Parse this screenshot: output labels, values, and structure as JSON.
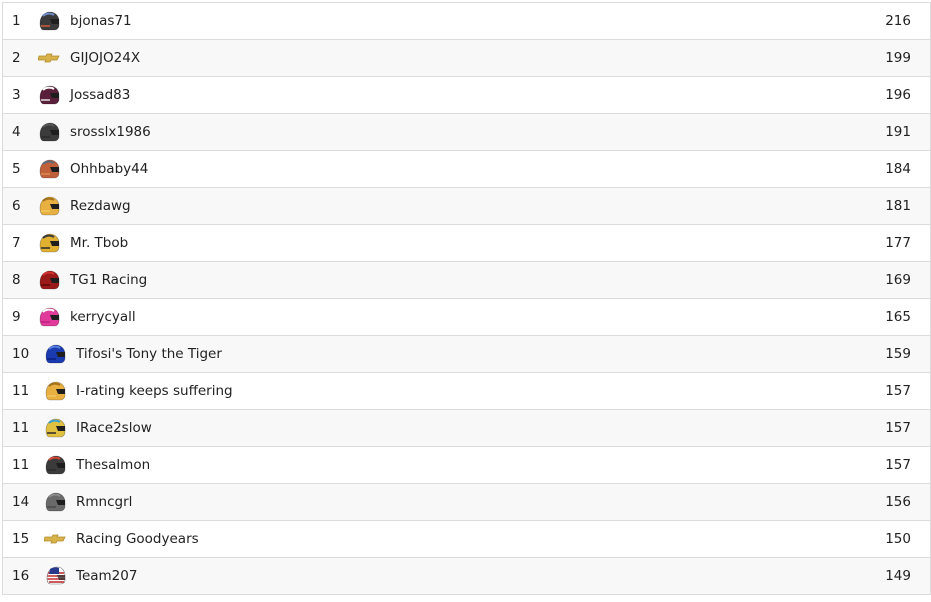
{
  "leaderboard": [
    {
      "rank": "1",
      "name": "bjonas71",
      "score": "216",
      "helmet": {
        "icon": "helmet-icon",
        "color": "#3a3a3a",
        "accent": "#6b8cc7",
        "stripe": "#d05a3a"
      }
    },
    {
      "rank": "2",
      "name": "GIJOJO24X",
      "score": "199",
      "helmet": {
        "icon": "chevrolet-bowtie-icon",
        "color": "#d8b24a",
        "accent": "#b08a2a",
        "stripe": "#d8b24a"
      }
    },
    {
      "rank": "3",
      "name": "Jossad83",
      "score": "196",
      "helmet": {
        "icon": "helmet-icon",
        "color": "#5a1f3a",
        "accent": "#ffffff",
        "stripe": "#e0e0e0"
      }
    },
    {
      "rank": "4",
      "name": "srosslx1986",
      "score": "191",
      "helmet": {
        "icon": "helmet-icon",
        "color": "#3b3b3b",
        "accent": "#555555",
        "stripe": "#2a2a2a"
      }
    },
    {
      "rank": "5",
      "name": "Ohhbaby44",
      "score": "184",
      "helmet": {
        "icon": "helmet-icon",
        "color": "#c0603a",
        "accent": "#5a6a7a",
        "stripe": "#e08a50"
      }
    },
    {
      "rank": "6",
      "name": "Rezdawg",
      "score": "181",
      "helmet": {
        "icon": "helmet-icon",
        "color": "#e8b040",
        "accent": "#a0701a",
        "stripe": "#f0c860"
      }
    },
    {
      "rank": "7",
      "name": "Mr. Tbob",
      "score": "177",
      "helmet": {
        "icon": "helmet-icon",
        "color": "#e0b030",
        "accent": "#3a3a3a",
        "stripe": "#2a2a2a"
      }
    },
    {
      "rank": "8",
      "name": "TG1 Racing",
      "score": "169",
      "helmet": {
        "icon": "helmet-icon",
        "color": "#9a1a1a",
        "accent": "#d03030",
        "stripe": "#600808"
      }
    },
    {
      "rank": "9",
      "name": "kerrycyall",
      "score": "165",
      "helmet": {
        "icon": "helmet-icon",
        "color": "#e03a9a",
        "accent": "#ffffff",
        "stripe": "#c02080"
      }
    },
    {
      "rank": "10",
      "name": "Tifosi's Tony the Tiger",
      "score": "159",
      "helmet": {
        "icon": "helmet-icon",
        "color": "#1a3ab0",
        "accent": "#5a80e0",
        "stripe": "#0a2080"
      }
    },
    {
      "rank": "11",
      "name": "I-rating keeps suffering",
      "score": "157",
      "helmet": {
        "icon": "helmet-icon",
        "color": "#e8b040",
        "accent": "#a0701a",
        "stripe": "#f0c860"
      }
    },
    {
      "rank": "11",
      "name": "IRace2slow",
      "score": "157",
      "helmet": {
        "icon": "helmet-icon",
        "color": "#e0c040",
        "accent": "#3aa0d0",
        "stripe": "#2a2a2a"
      }
    },
    {
      "rank": "11",
      "name": "Thesalmon",
      "score": "157",
      "helmet": {
        "icon": "helmet-icon",
        "color": "#3b3b3b",
        "accent": "#d04a3a",
        "stripe": "#2a2a2a"
      }
    },
    {
      "rank": "14",
      "name": "Rmncgrl",
      "score": "156",
      "helmet": {
        "icon": "helmet-icon",
        "color": "#6a6a6a",
        "accent": "#8a8a8a",
        "stripe": "#4a4a4a"
      }
    },
    {
      "rank": "15",
      "name": "Racing Goodyears",
      "score": "150",
      "helmet": {
        "icon": "chevrolet-bowtie-icon",
        "color": "#d8b24a",
        "accent": "#b08a2a",
        "stripe": "#d8b24a"
      }
    },
    {
      "rank": "16",
      "name": "Team207",
      "score": "149",
      "helmet": {
        "icon": "us-flag-helmet-icon",
        "color": "#c03030",
        "accent": "#2a3a8a",
        "stripe": "#ffffff"
      }
    }
  ]
}
